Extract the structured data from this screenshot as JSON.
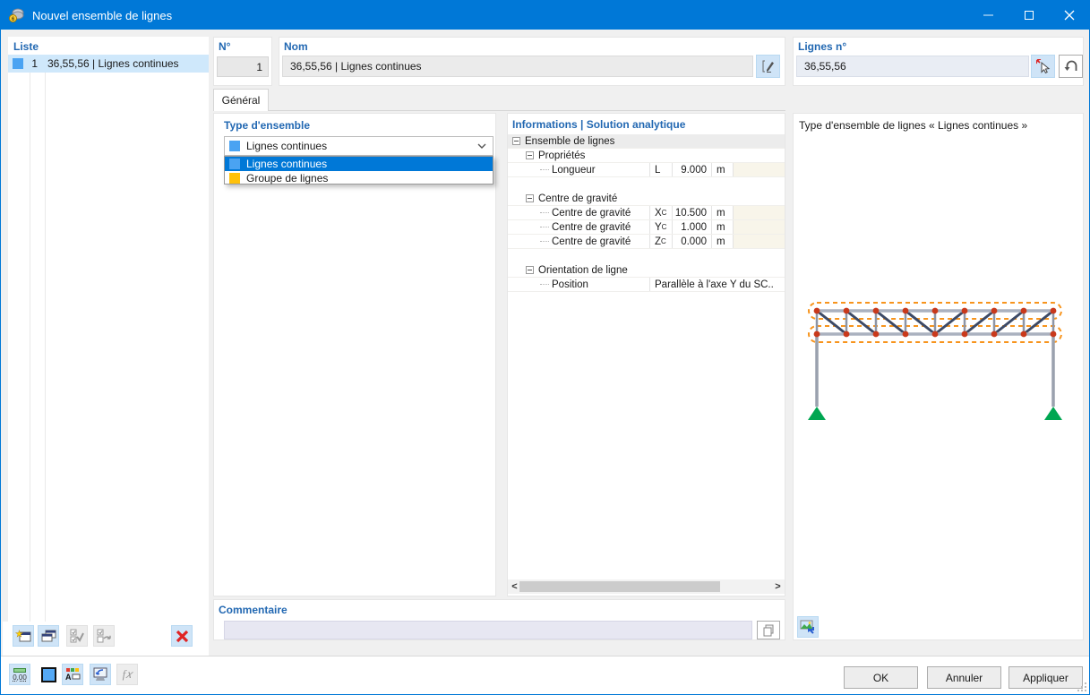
{
  "window": {
    "title": "Nouvel ensemble de lignes"
  },
  "colors": {
    "accent": "#0078d7",
    "label-blue": "#2268b2",
    "swatch-blue": "#4aa3f2",
    "swatch-yellow": "#ffc10a",
    "selection-bg": "#cfe8fb",
    "btn-blue": "#cfe4f7",
    "delete-red": "#e02424",
    "cream": "#f8f5ea",
    "node-red": "#c9391b",
    "member-dark": "#3d4a66",
    "member-grey": "#aab1bf",
    "support-green": "#00a651",
    "dashed-orange": "#f7941d"
  },
  "list_panel": {
    "header": "Liste",
    "item": {
      "num": "1",
      "text": "36,55,56 | Lignes continues"
    }
  },
  "fields": {
    "no_label": "N°",
    "no_value": "1",
    "name_label": "Nom",
    "name_value": "36,55,56 | Lignes continues",
    "lines_label": "Lignes n°",
    "lines_value": "36,55,56"
  },
  "tabs": {
    "general": "Général"
  },
  "type_panel": {
    "label": "Type d'ensemble",
    "selected": "Lignes continues",
    "options": [
      {
        "label": "Lignes continues"
      },
      {
        "label": "Groupe de lignes"
      }
    ]
  },
  "info_panel": {
    "header": "Informations | Solution analytique",
    "rows": [
      {
        "label": "Ensemble de lignes"
      },
      {
        "label": "Propriétés"
      },
      {
        "label": "Longueur",
        "sym": "L",
        "sub": "",
        "val": "9.000",
        "unit": "m"
      },
      {
        "label": ""
      },
      {
        "label": "Centre de gravité"
      },
      {
        "label": "Centre de gravité",
        "sym": "X",
        "sub": "C",
        "val": "10.500",
        "unit": "m"
      },
      {
        "label": "Centre de gravité",
        "sym": "Y",
        "sub": "C",
        "val": "1.000",
        "unit": "m"
      },
      {
        "label": "Centre de gravité",
        "sym": "Z",
        "sub": "C",
        "val": "0.000",
        "unit": "m"
      },
      {
        "label": ""
      },
      {
        "label": "Orientation de ligne"
      },
      {
        "label": "Position",
        "val": "Parallèle à l'axe Y du SC.."
      }
    ],
    "scroll": {
      "left": "<",
      "right": ">"
    }
  },
  "preview_panel": {
    "title": "Type d'ensemble de lignes « Lignes continues »"
  },
  "comment_panel": {
    "label": "Commentaire",
    "value": ""
  },
  "buttons": {
    "ok": "OK",
    "cancel": "Annuler",
    "apply": "Appliquer"
  },
  "toolbar": {
    "decimal_label": "0,00"
  }
}
